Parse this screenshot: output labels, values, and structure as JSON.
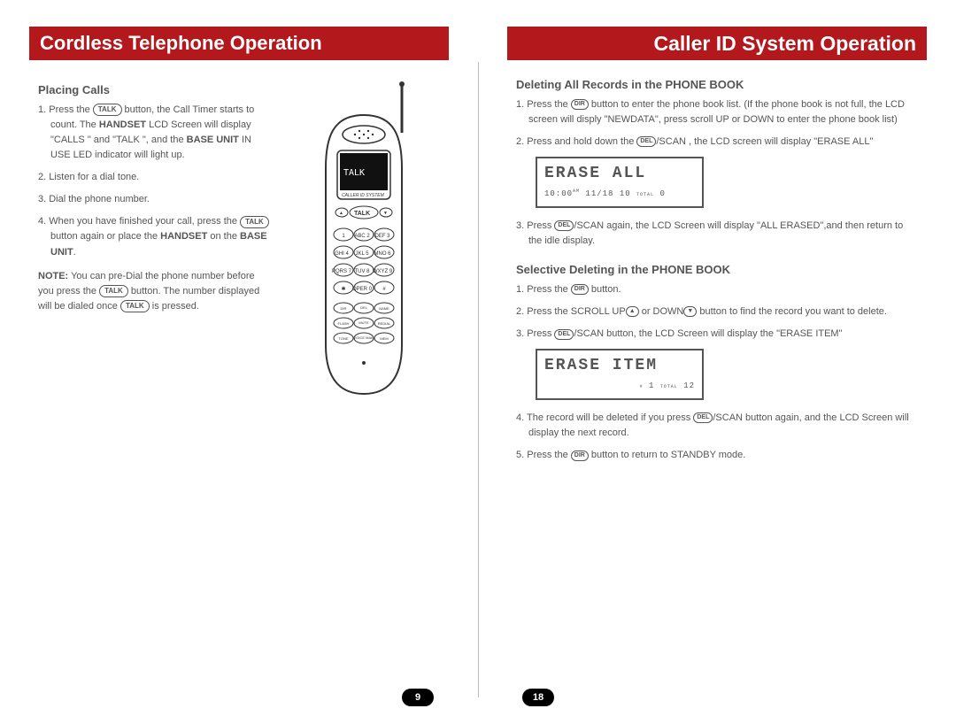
{
  "left": {
    "header": "Cordless Telephone Operation",
    "section_title": "Placing Calls",
    "step1_a": "1. Press the ",
    "btn_talk": "TALK",
    "step1_b": " button,  the  Call  Timer starts to count. The ",
    "step1_bold1": "HANDSET",
    "step1_c": " LCD Screen will display \"CALLS \"  and  \"TALK \",  and  the  ",
    "step1_bold2": "BASE  UNIT",
    "step1_d": " IN USE LED indicator will light up.",
    "step2": "2. Listen for a dial tone.",
    "step3": "3. Dial the phone number.",
    "step4_a": "4. When you have finished your call, press the ",
    "step4_b": " button again or place the ",
    "step4_bold": "HANDSET",
    "step4_c": " on the ",
    "step4_bold2": "BASE UNIT",
    "step4_d": ".",
    "note_label": "NOTE:",
    "note_a": " You  can  pre-Dial  the phone number before you press the ",
    "note_b": " button. The number displayed will be dialed once ",
    "note_c": " is pressed.",
    "pagenum": "9",
    "handset_screen": "TALK",
    "handset_sub": "CALLER ID SYSTEM"
  },
  "right": {
    "header": "Caller ID System Operation",
    "sec1_title": "Deleting All Records in the PHONE BOOK",
    "s1_1a": "1. Press the ",
    "btn_dir": "DIR",
    "s1_1b": " button to enter the phone book list. (If the phone book is not full, the LCD screen will disply \"NEWDATA\", press scroll UP or DOWN to enter the phone book list)",
    "s1_2a": "2. Press and hold down the ",
    "btn_del": "DEL",
    "scan": "/SCAN",
    "s1_2b": " ,  the LCD screen will display  \"ERASE  ALL\"",
    "lcd1_line1": "ERASE ALL",
    "lcd1_line2_a": "10:00",
    "lcd1_line2_b": "AM",
    "lcd1_line2_c": " 11/18   10 ",
    "lcd1_line2_d": "TOTAL",
    "lcd1_line2_e": " 0",
    "s1_3a": "3. Press ",
    "s1_3b": "/SCAN  again,  the LCD Screen will display \"ALL ERASED\",and then return to the idle display.",
    "sec2_title": "Selective Deleting in the PHONE BOOK",
    "s2_1a": "1. Press the ",
    "s2_1b": " button.",
    "s2_2a": "2. Press the SCROLL UP",
    "arrow_up": "▲",
    "s2_2b": " or DOWN",
    "arrow_dn": "▼",
    "s2_2c": " button to find the record you want to delete.",
    "s2_3a": "3. Press ",
    "s2_3b": "/SCAN button, the LCD Screen will display the \"ERASE ITEM\"",
    "lcd2_line1": "ERASE ITEM",
    "lcd2_line2_a": "#",
    "lcd2_line2_b": " 1 ",
    "lcd2_line2_c": "TOTAL",
    "lcd2_line2_d": " 12",
    "s2_4a": "4. The record will be deleted if  you press",
    "s2_4b": "/SCAN button again, and the LCD Screen will display the next record.",
    "s2_5a": "5. Press the ",
    "s2_5b": " button  to return to STANDBY mode.",
    "pagenum": "18"
  }
}
